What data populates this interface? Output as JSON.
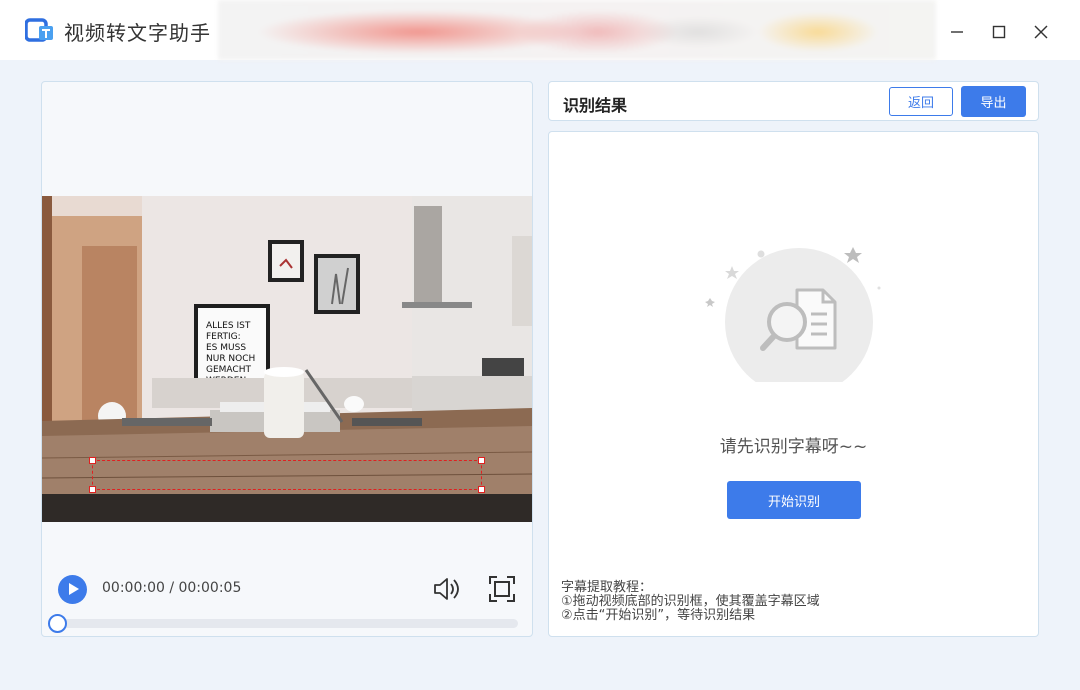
{
  "app": {
    "title": "视频转文字助手",
    "logo_icon": "app-logo-icon"
  },
  "window_controls": {
    "minimize_icon": "minimize-icon",
    "maximize_icon": "maximize-icon",
    "close_icon": "close-icon"
  },
  "player": {
    "time": "00:00:00 / 00:00:05",
    "progress": 0,
    "icons": [
      "play-icon",
      "volume-icon",
      "fullscreen-icon"
    ]
  },
  "result": {
    "title": "识别结果",
    "back_label": "返回",
    "export_label": "导出",
    "empty_text": "请先识别字幕呀~~",
    "start_label": "开始识别",
    "tutorial": {
      "heading": "字幕提取教程：",
      "step1": "①拖动视频底部的识别框，使其覆盖字幕区域",
      "step2": "②点击“开始识别”，等待识别结果"
    }
  },
  "video": {
    "poster_text": [
      "ALLES IST",
      "FERTIG:",
      "ES MUSS",
      "NUR NOCH",
      "GEMACHT",
      "WERDEN."
    ]
  },
  "colors": {
    "accent": "#3d7bea",
    "subtitle_box": "#e02020",
    "background": "#eef3fa"
  }
}
